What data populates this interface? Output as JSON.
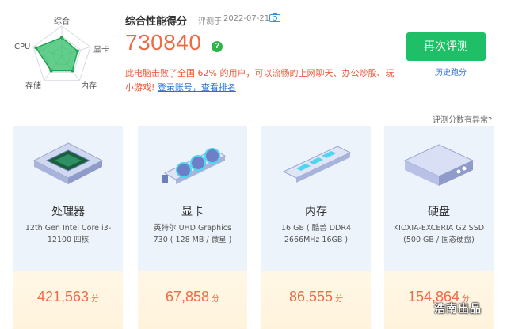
{
  "radar": {
    "labels": {
      "overall": "综合",
      "gpu": "显卡",
      "memory": "内存",
      "storage": "存储",
      "cpu": "CPU"
    },
    "levels": {
      "overall": 0.62,
      "gpu": 0.55,
      "memory": 0.6,
      "storage": 0.6,
      "cpu": 0.9
    }
  },
  "header": {
    "title": "综合性能得分",
    "date_label": "评测于",
    "date": "2022-07-21",
    "score": "730840",
    "help_glyph": "?",
    "beat_text": "此电脑击败了全国 62% 的用户，可以流畅的上网聊天、办公炒股、玩小游戏!",
    "beat_links": "登录账号，查看排名"
  },
  "actions": {
    "retest": "再次评测",
    "history": "历史跑分",
    "anomaly": "评测分数有异常?"
  },
  "cards": [
    {
      "name": "处理器",
      "spec": "12th Gen Intel Core i3-12100 四核",
      "score": "421,563",
      "unit": "分"
    },
    {
      "name": "显卡",
      "spec": "英特尔 UHD Graphics 730 ( 128 MB / 微星 )",
      "score": "67,858",
      "unit": "分"
    },
    {
      "name": "内存",
      "spec": "16 GB ( 酷兽 DDR4 2666MHz 16GB )",
      "score": "86,555",
      "unit": "分"
    },
    {
      "name": "硬盘",
      "spec": "KIOXIA-EXCERIA G2 SSD (500 GB / 固态硬盘)",
      "score": "154,864",
      "unit": "分"
    }
  ],
  "watermark": "浩南出品",
  "colors": {
    "accent_green": "#1fbf67",
    "score_orange": "#ef6a45",
    "link_blue": "#2a6fd6",
    "card_bg": "#edf3fb",
    "card_bottom_bg": "#fff7e6"
  }
}
